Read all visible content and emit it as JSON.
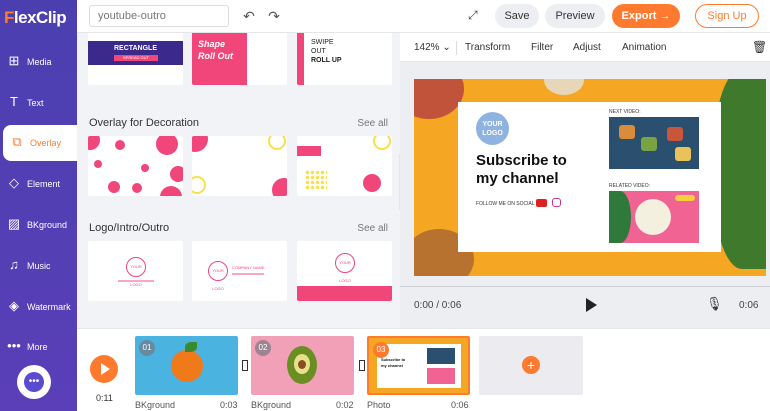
{
  "app": {
    "logo_prefix": "F",
    "logo_rest": "lexClip"
  },
  "sidebar": {
    "items": [
      {
        "label": "Media",
        "icon": "media-icon"
      },
      {
        "label": "Text",
        "icon": "text-icon"
      },
      {
        "label": "Overlay",
        "icon": "overlay-icon",
        "active": true
      },
      {
        "label": "Element",
        "icon": "element-icon"
      },
      {
        "label": "BKground",
        "icon": "background-icon"
      },
      {
        "label": "Music",
        "icon": "music-icon"
      },
      {
        "label": "Watermark",
        "icon": "watermark-icon"
      },
      {
        "label": "More",
        "icon": "more-icon"
      }
    ],
    "chat_icon": "chat-icon"
  },
  "topbar": {
    "project_name_placeholder": "youtube-outro",
    "save": "Save",
    "preview": "Preview",
    "export": "Export",
    "signup": "Sign Up"
  },
  "library": {
    "top_row": [
      {
        "line1": "RECTANGLE",
        "line2": "SPREAD OUT"
      },
      {
        "line1": "Shape",
        "line2": "Roll Out"
      },
      {
        "line1": "SWIPE",
        "line2": "OUT",
        "line3": "ROLL UP"
      }
    ],
    "sections": [
      {
        "title": "Overlay for Decoration",
        "see_all": "See all"
      },
      {
        "title": "Logo/Intro/Outro",
        "see_all": "See all"
      }
    ],
    "logo_thumbs": [
      {
        "logo": "YOUR LOGO"
      },
      {
        "logo": "YOUR LOGO",
        "company": "COMPANY NAME"
      },
      {
        "logo": "YOUR LOGO"
      }
    ]
  },
  "editor": {
    "zoom": "142%",
    "tools": [
      "Transform",
      "Filter",
      "Adjust",
      "Animation"
    ],
    "canvas": {
      "logo_line1": "YOUR",
      "logo_line2": "LOGO",
      "headline_line1": "Subscribe to",
      "headline_line2": "my channel",
      "follow": "FOLLOW ME ON SOCIAL",
      "next_video": "NEXT VIDEO:",
      "related_video": "RELATED VIDEO:"
    },
    "current_time": "0:00 / 0:06",
    "total_time": "0:06"
  },
  "timeline": {
    "current": "0:11",
    "clips": [
      {
        "num": "01",
        "label": "BKground",
        "duration": "0:03"
      },
      {
        "num": "02",
        "label": "BKground",
        "duration": "0:02"
      },
      {
        "num": "03",
        "label": "Photo",
        "duration": "0:06"
      }
    ],
    "add": "+"
  },
  "colors": {
    "accent": "#ff7a2e",
    "sidebar": "#4b3fb0",
    "pink": "#f0467a"
  }
}
